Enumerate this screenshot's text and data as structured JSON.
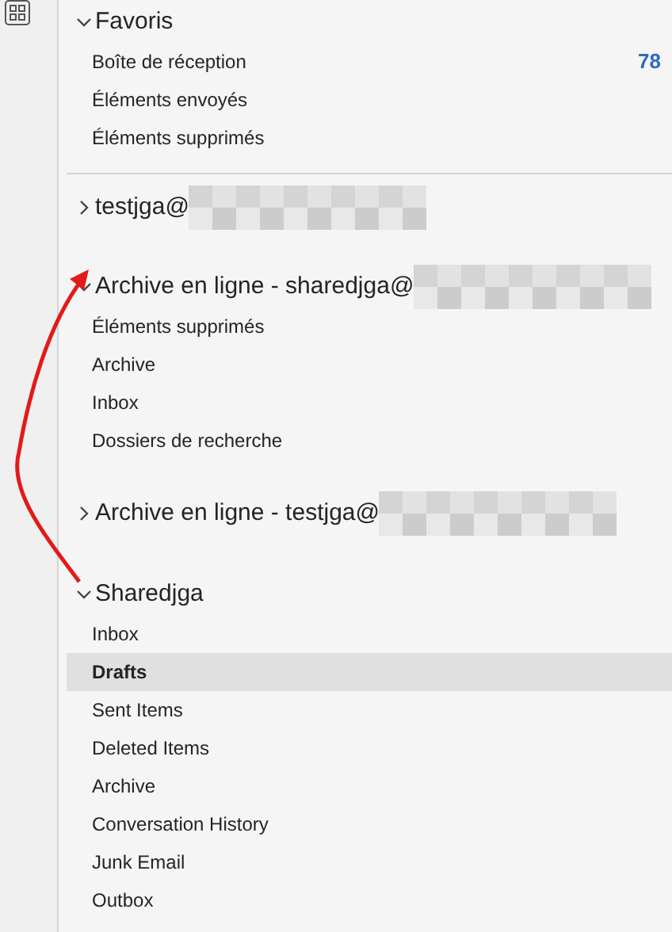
{
  "sections": [
    {
      "kind": "favorites",
      "title": "Favoris",
      "expanded": true,
      "items": [
        {
          "label": "Boîte de réception",
          "selected": false,
          "count": "78"
        },
        {
          "label": "Éléments envoyés",
          "selected": false
        },
        {
          "label": "Éléments supprimés",
          "selected": false
        }
      ]
    },
    {
      "kind": "account",
      "title": "testjga@",
      "redacted": true,
      "expanded": false
    },
    {
      "kind": "account",
      "title": "Archive en ligne - sharedjga@",
      "redacted": true,
      "expanded": true,
      "items": [
        {
          "label": "Éléments supprimés",
          "selected": false
        },
        {
          "label": "Archive",
          "selected": false
        },
        {
          "label": "Inbox",
          "selected": false
        },
        {
          "label": "Dossiers de recherche",
          "selected": false
        }
      ]
    },
    {
      "kind": "account",
      "title": "Archive en ligne - testjga@",
      "redacted": true,
      "expanded": false
    },
    {
      "kind": "account",
      "title": "Sharedjga",
      "redacted": false,
      "expanded": true,
      "items": [
        {
          "label": "Inbox",
          "selected": false
        },
        {
          "label": "Drafts",
          "selected": true
        },
        {
          "label": "Sent Items",
          "selected": false
        },
        {
          "label": "Deleted Items",
          "selected": false
        },
        {
          "label": "Archive",
          "selected": false
        },
        {
          "label": "Conversation History",
          "selected": false
        },
        {
          "label": "Junk Email",
          "selected": false
        },
        {
          "label": "Outbox",
          "selected": false
        }
      ]
    }
  ],
  "annotation": {
    "kind": "arrow"
  }
}
